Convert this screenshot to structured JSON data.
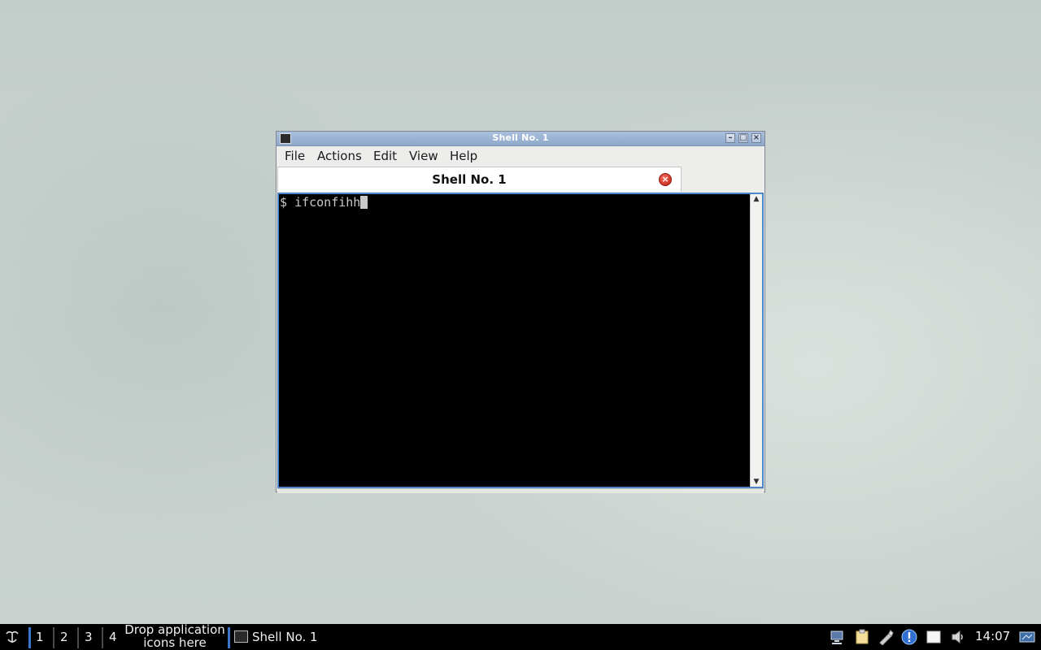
{
  "window": {
    "title": "Shell No. 1",
    "menu": [
      "File",
      "Actions",
      "Edit",
      "View",
      "Help"
    ],
    "tab_label": "Shell No. 1",
    "terminal_prompt": "$ ",
    "terminal_input": "ifconfihh"
  },
  "taskbar": {
    "workspaces": [
      "1",
      "2",
      "3",
      "4"
    ],
    "launcher_hint_line1": "Drop application",
    "launcher_hint_line2": "icons here",
    "task_label": "Shell No. 1",
    "clock": "14:07"
  },
  "icons": {
    "start": "start-menu-icon",
    "terminal": "terminal-icon",
    "tab_close": "close-circle-icon",
    "tray": [
      "network-icon",
      "clipboard-icon",
      "pen-tool-icon",
      "info-icon",
      "notes-icon",
      "volume-icon",
      "display-icon"
    ]
  },
  "colors": {
    "titlebar": "#9ab1d2",
    "terminal_bg": "#000000",
    "terminal_fg": "#c8c8c8",
    "focus_border": "#4a86c8",
    "taskbar_bg": "#000000",
    "tab_close": "#d9342a"
  }
}
